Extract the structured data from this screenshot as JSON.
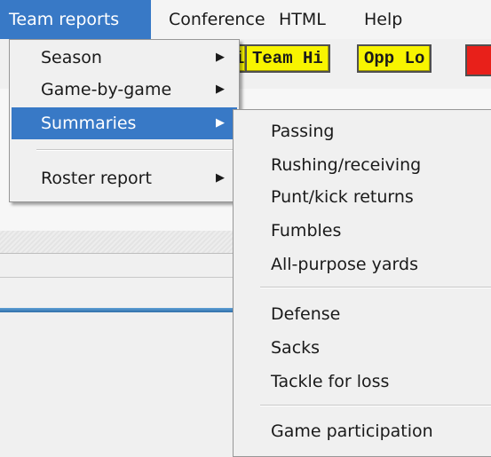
{
  "menubar": {
    "team_reports": "Team reports",
    "conference": "Conference",
    "html": "HTML",
    "help": "Help"
  },
  "toolbar": {
    "partial_button": "i",
    "team_hi": "Team Hi",
    "opp_lo": "Opp Lo"
  },
  "main_menu": {
    "items": [
      {
        "label": "Season",
        "submenu": true
      },
      {
        "label": "Game-by-game",
        "submenu": true
      },
      {
        "label": "Summaries",
        "submenu": true,
        "highlighted": true
      },
      {
        "label": "Roster report",
        "submenu": true
      }
    ]
  },
  "sub_menu": {
    "items": [
      {
        "label": "Passing"
      },
      {
        "label": "Rushing/receiving"
      },
      {
        "label": "Punt/kick returns"
      },
      {
        "label": "Fumbles"
      },
      {
        "label": "All-purpose yards"
      },
      {
        "label": "Defense"
      },
      {
        "label": "Sacks"
      },
      {
        "label": "Tackle for loss"
      },
      {
        "label": "Game participation"
      }
    ]
  },
  "icons": {
    "submenu_arrow": "arrow-right-icon"
  },
  "colors": {
    "highlight": "#3879c6",
    "toolbar_button": "#f8f400",
    "red_button": "#e8201a"
  }
}
